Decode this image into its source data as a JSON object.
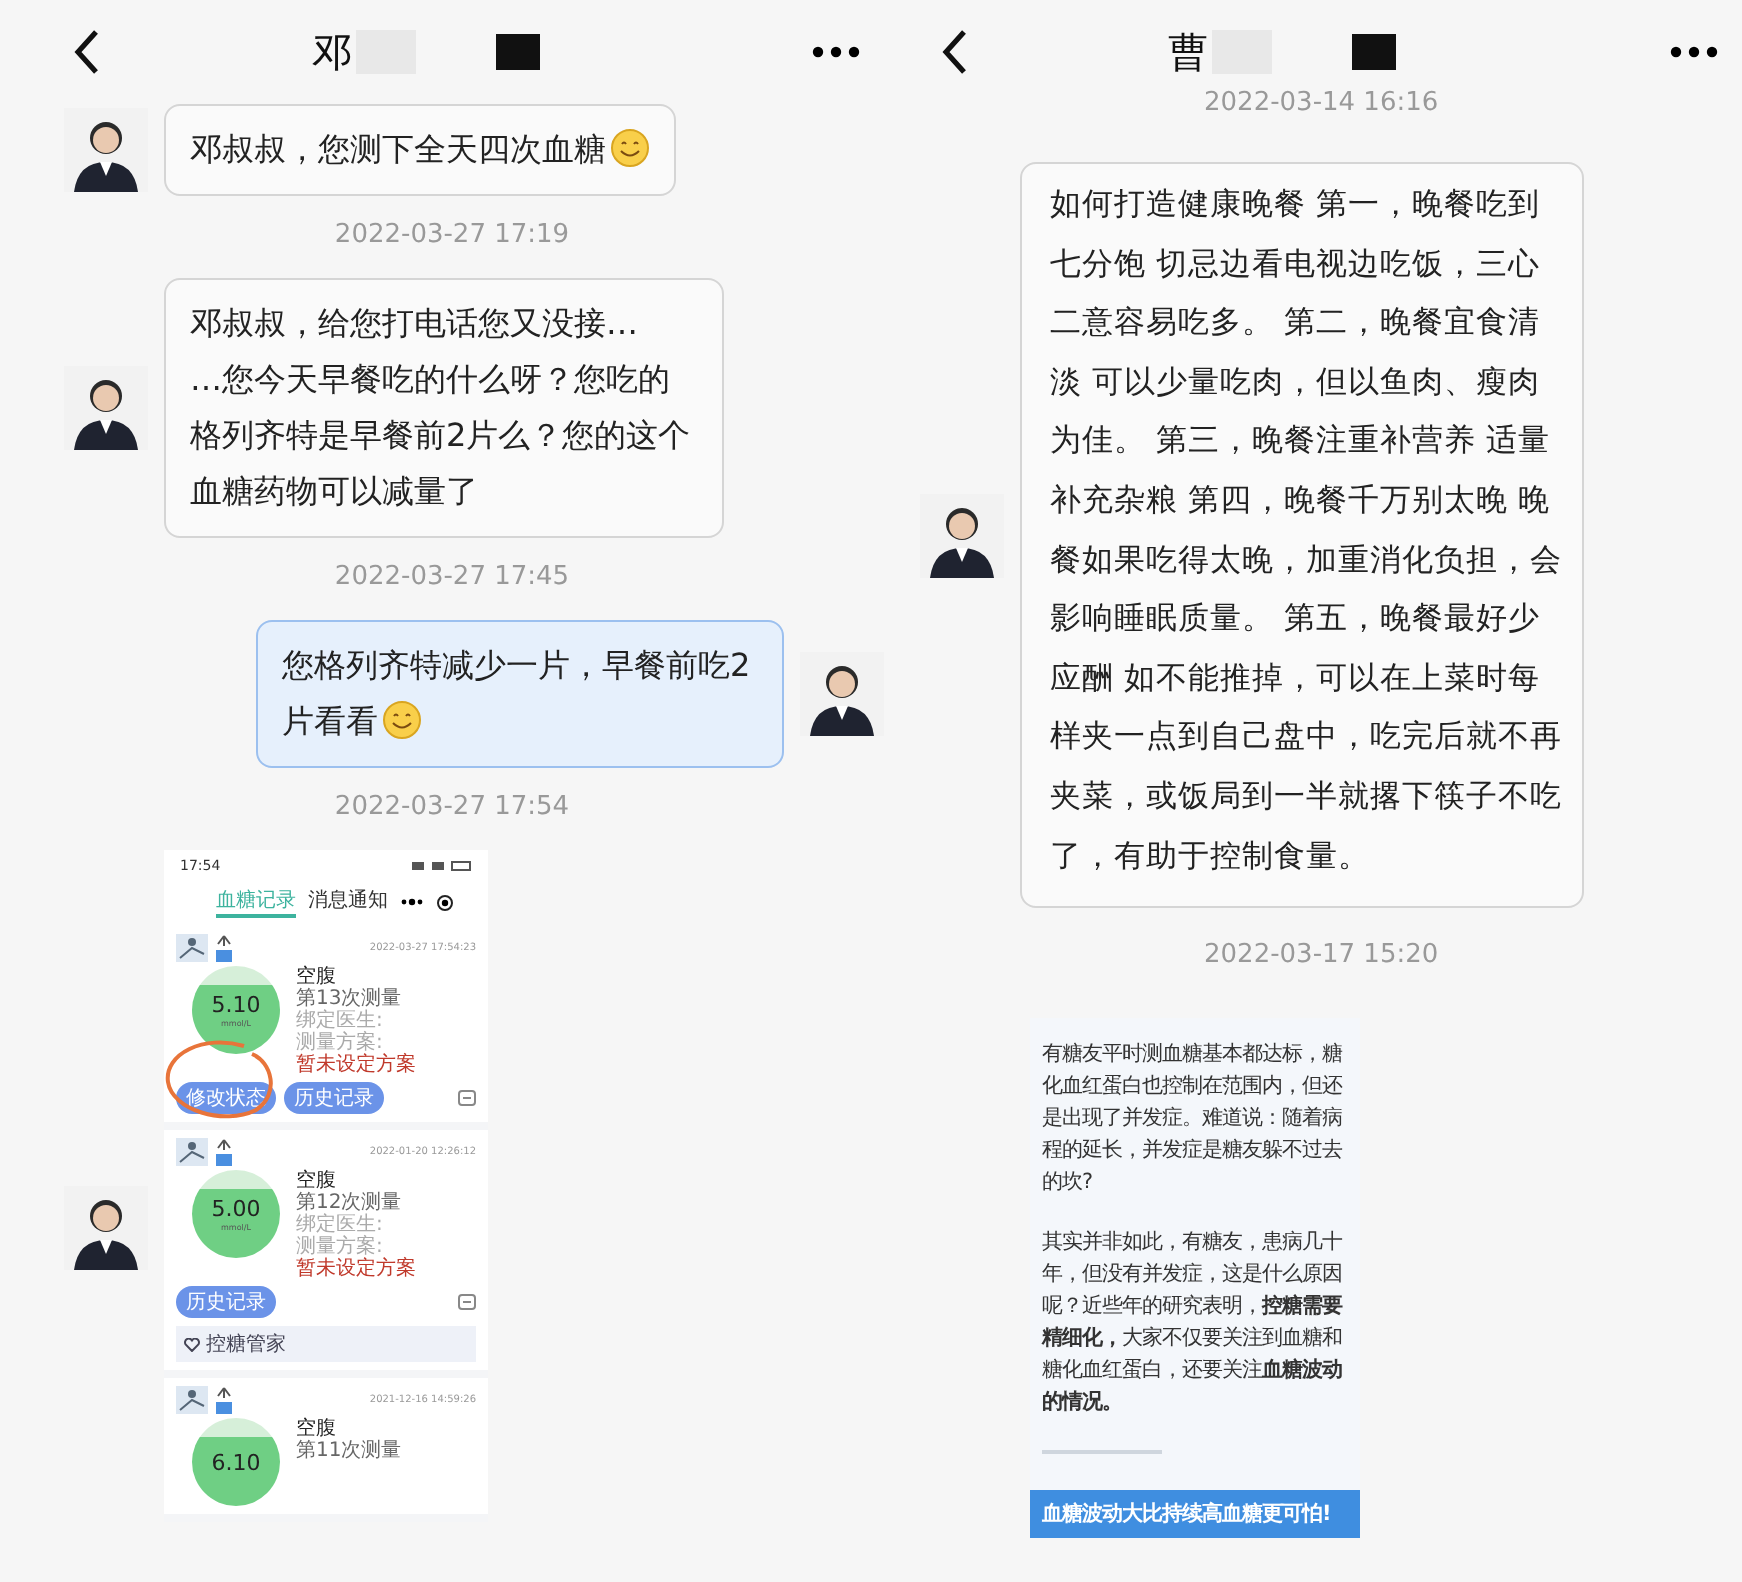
{
  "left": {
    "title": "邓",
    "messages": [
      {
        "kind": "text",
        "outgoing": false,
        "text": "邓叔叔，您测下全天四次血糖",
        "emoji": true
      },
      {
        "kind": "time",
        "text": "2022-03-27 17:19"
      },
      {
        "kind": "text",
        "outgoing": false,
        "text": "邓叔叔，给您打电话您又没接…\n…您今天早餐吃的什么呀？您吃的格列齐特是早餐前2片么？您的这个血糖药物可以减量了",
        "emoji": false
      },
      {
        "kind": "time",
        "text": "2022-03-27 17:45"
      },
      {
        "kind": "text",
        "outgoing": true,
        "text": "您格列齐特减少一片，早餐前吃2片看看",
        "emoji": true
      },
      {
        "kind": "time",
        "text": "2022-03-27 17:54"
      },
      {
        "kind": "screenshot",
        "status_time": "17:54",
        "tabs": [
          {
            "label": "血糖记录",
            "selected": true
          },
          {
            "label": "消息通知",
            "selected": false
          }
        ],
        "records": [
          {
            "time": "2022-03-27 17:54:23",
            "meal": "空腹",
            "count": "第13次测量",
            "value": "5.10",
            "unit": "mmol/L",
            "lines": [
              "绑定医生:",
              "测量方案:"
            ],
            "plan": "暂未设定方案",
            "buttons": [
              "修改状态",
              "历史记录"
            ],
            "circled": true
          },
          {
            "time": "2022-01-20 12:26:12",
            "meal": "空腹",
            "count": "第12次测量",
            "value": "5.00",
            "unit": "mmol/L",
            "lines": [
              "绑定医生:",
              "测量方案:"
            ],
            "plan": "暂未设定方案",
            "buttons": [
              "历史记录"
            ],
            "circled": false,
            "banner": "控糖管家"
          },
          {
            "time": "2021-12-16 14:59:26",
            "meal": "空腹",
            "count": "第11次测量",
            "value": "6.10"
          }
        ]
      }
    ]
  },
  "right": {
    "title": "曹",
    "messages": [
      {
        "kind": "time",
        "text": "2022-03-14 16:16"
      },
      {
        "kind": "text",
        "outgoing": false,
        "text": "如何打造健康晚餐 第一，晚餐吃到七分饱 切忌边看电视边吃饭，三心二意容易吃多。 第二，晚餐宜食清淡 可以少量吃肉，但以鱼肉、瘦肉为佳。 第三，晚餐注重补营养 适量补充杂粮 第四，晚餐千万别太晚 晚餐如果吃得太晚，加重消化负担，会影响睡眠质量。 第五，晚餐最好少应酬 如不能推掉，可以在上菜时每样夹一点到自己盘中，吃完后就不再夹菜，或饭局到一半就撂下筷子不吃了，有助于控制食量。",
        "emoji": false
      },
      {
        "kind": "time",
        "text": "2022-03-17 15:20"
      },
      {
        "kind": "article",
        "paragraphs": [
          "有糖友平时测血糖基本都达标，糖化血红蛋白也控制在范围内，但还是出现了并发症。难道说：随着病程的延长，并发症是糖友躲不过去的坎?",
          "其实并非如此，有糖友，患病几十年，但没有并发症，这是什么原因呢？近些年的研究表明，**控糖需要精细化，**大家不仅要关注到血糖和糖化血红蛋白，还要关注**血糖波动的情况。**"
        ],
        "banner": "血糖波动大比持续高血糖更可怕!"
      }
    ]
  }
}
